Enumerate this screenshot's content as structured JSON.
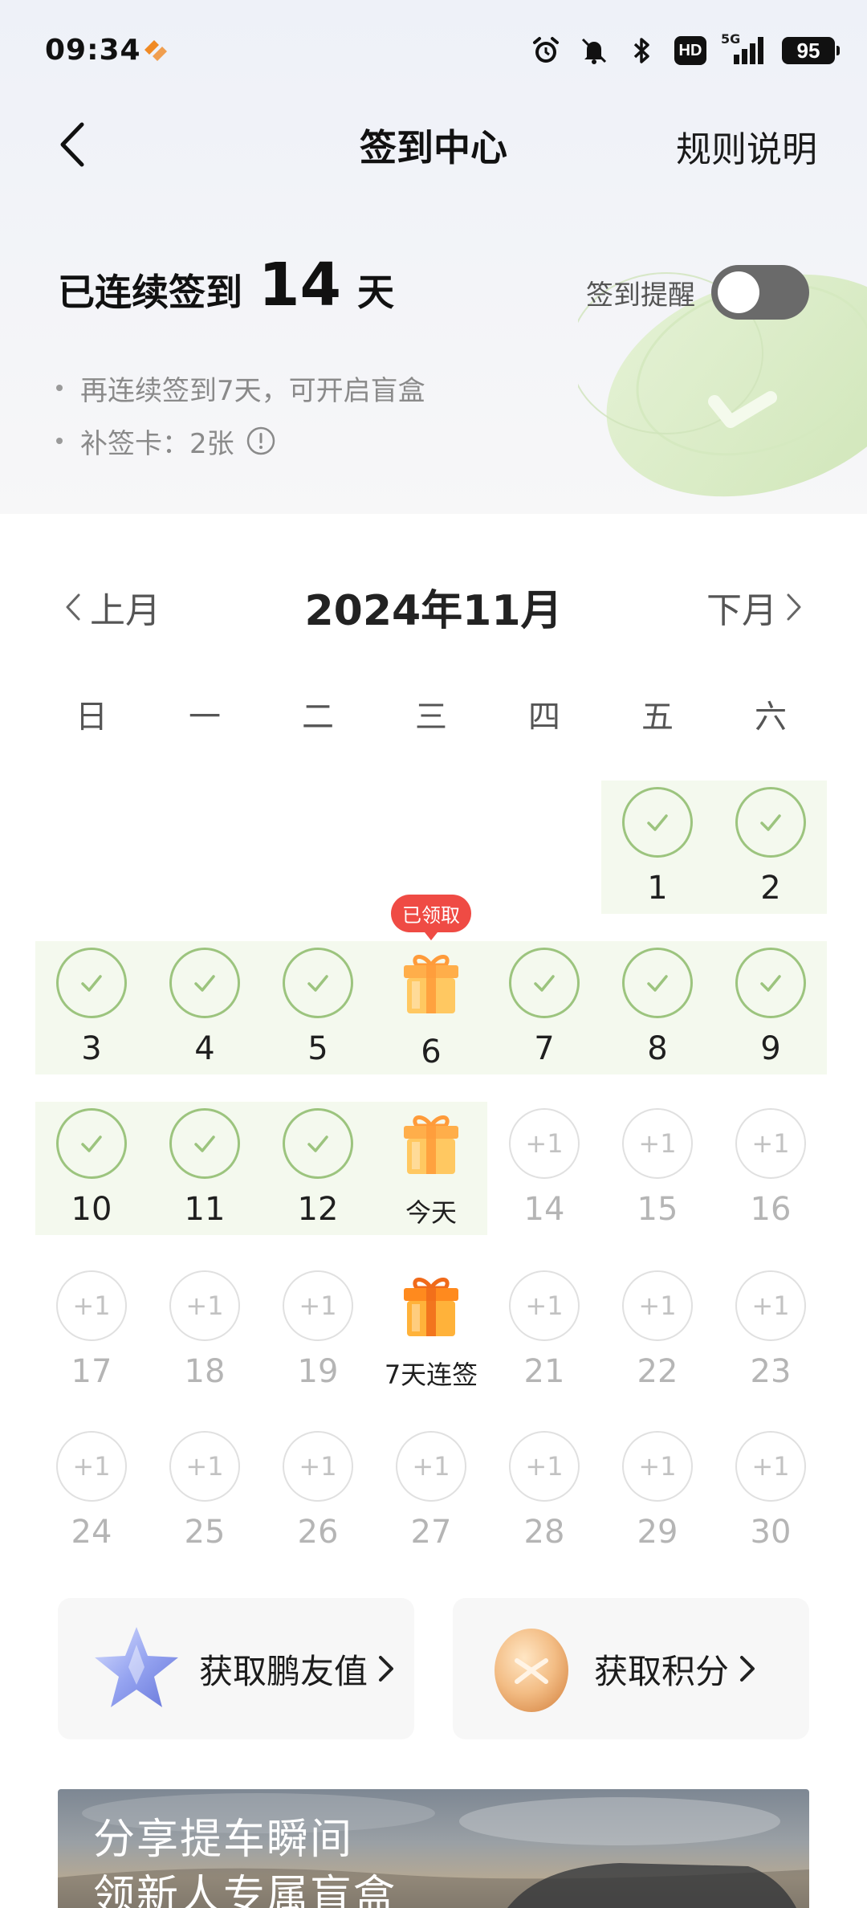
{
  "status_bar": {
    "time": "09:34",
    "hd": "HD",
    "network": "5G",
    "battery": "95",
    "icons": [
      "app-notification-icon",
      "alarm-icon",
      "mute-icon",
      "bluetooth-icon",
      "hd-icon",
      "signal-icon",
      "battery-icon"
    ]
  },
  "header": {
    "title": "签到中心",
    "rules_label": "规则说明"
  },
  "streak": {
    "label": "已连续签到",
    "days": "14",
    "unit": "天"
  },
  "reminder": {
    "label": "签到提醒",
    "enabled": false
  },
  "tips": [
    "再连续签到7天，可开启盲盒",
    "补签卡：2张"
  ],
  "calendar": {
    "prev_label": "上月",
    "next_label": "下月",
    "title": "2024年11月",
    "weekdays": [
      "日",
      "一",
      "二",
      "三",
      "四",
      "五",
      "六"
    ],
    "claimed_badge": "已领取",
    "plus_label": "+1",
    "days": [
      {
        "label": "1",
        "state": "checked"
      },
      {
        "label": "2",
        "state": "checked"
      },
      {
        "label": "3",
        "state": "checked"
      },
      {
        "label": "4",
        "state": "checked"
      },
      {
        "label": "5",
        "state": "checked"
      },
      {
        "label": "6",
        "state": "gift-claimed"
      },
      {
        "label": "7",
        "state": "checked"
      },
      {
        "label": "8",
        "state": "checked"
      },
      {
        "label": "9",
        "state": "checked"
      },
      {
        "label": "10",
        "state": "checked"
      },
      {
        "label": "11",
        "state": "checked"
      },
      {
        "label": "12",
        "state": "checked"
      },
      {
        "label": "今天",
        "state": "gift-today"
      },
      {
        "label": "14",
        "state": "future"
      },
      {
        "label": "15",
        "state": "future"
      },
      {
        "label": "16",
        "state": "future"
      },
      {
        "label": "17",
        "state": "future"
      },
      {
        "label": "18",
        "state": "future"
      },
      {
        "label": "19",
        "state": "future"
      },
      {
        "label": "7天连签",
        "state": "gift-future"
      },
      {
        "label": "21",
        "state": "future"
      },
      {
        "label": "22",
        "state": "future"
      },
      {
        "label": "23",
        "state": "future"
      },
      {
        "label": "24",
        "state": "future"
      },
      {
        "label": "25",
        "state": "future"
      },
      {
        "label": "26",
        "state": "future"
      },
      {
        "label": "27",
        "state": "future"
      },
      {
        "label": "28",
        "state": "future"
      },
      {
        "label": "29",
        "state": "future"
      },
      {
        "label": "30",
        "state": "future"
      }
    ]
  },
  "cards": [
    {
      "label": "获取鹏友值",
      "icon": "star-icon"
    },
    {
      "label": "获取积分",
      "icon": "coin-icon"
    }
  ],
  "banner": {
    "line1": "分享提车瞬间",
    "line2": "领新人专属盲盒"
  },
  "colors": {
    "check_green": "#9cc47e",
    "week_bg": "#f4f9ee",
    "badge_red": "#ef4b44",
    "toggle_off": "#6a6a6a"
  }
}
